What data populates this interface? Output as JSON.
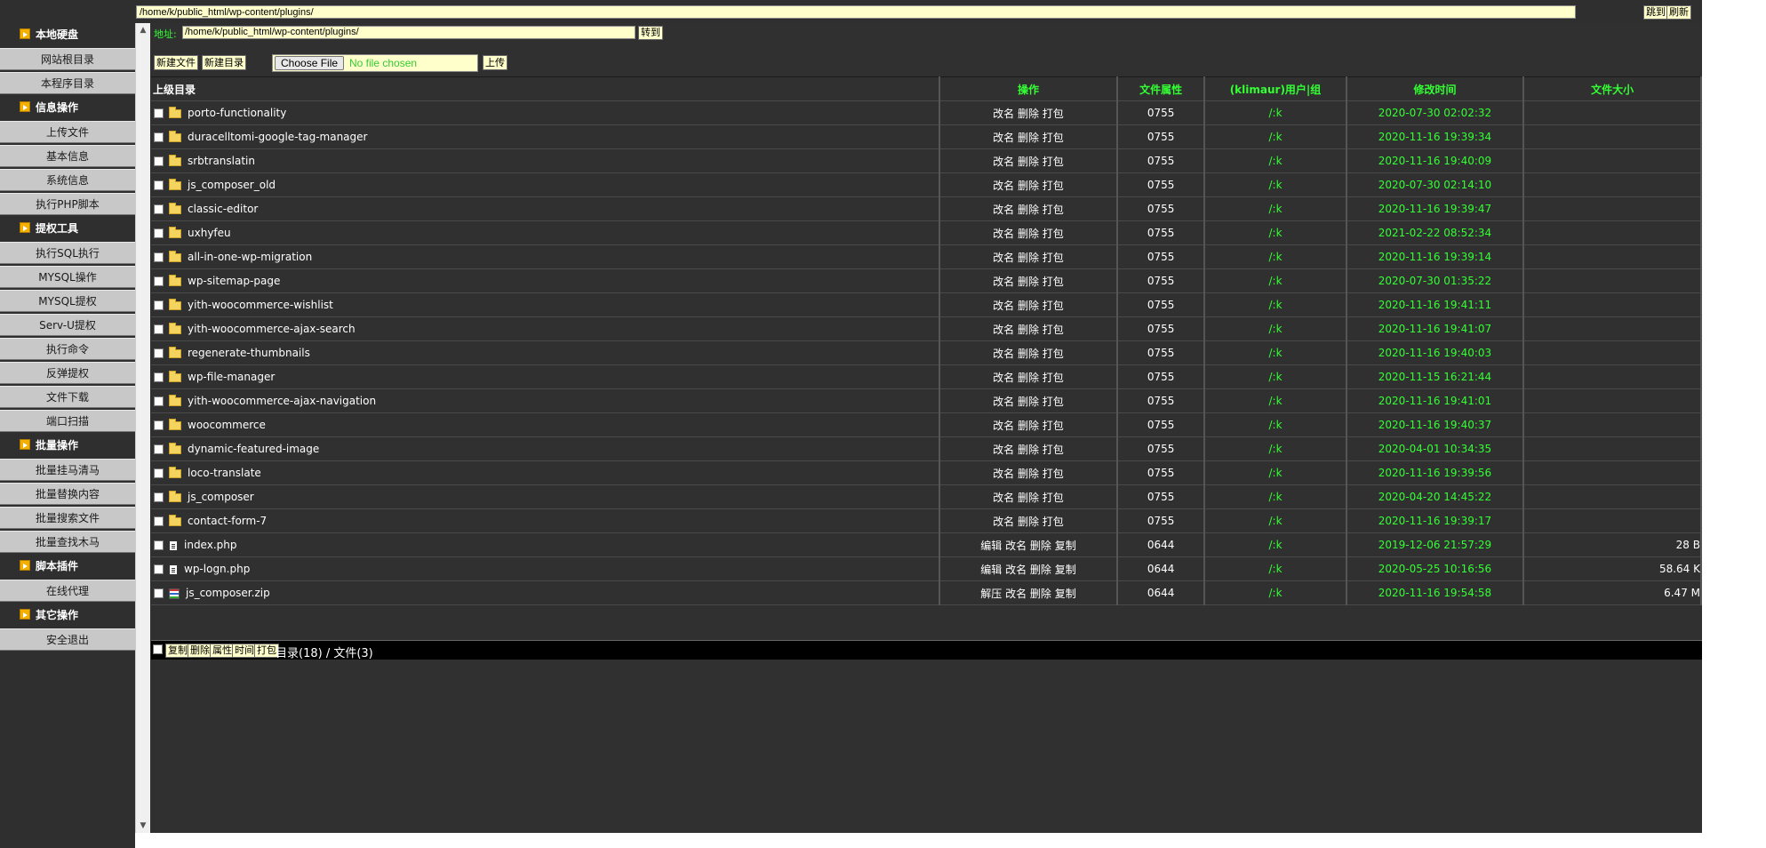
{
  "topbar": {
    "path": "/home/k/public_html/wp-content/plugins/",
    "jump_label": "跳到",
    "refresh_label": "刷新"
  },
  "sidebar": {
    "sections": [
      {
        "title": "本地硬盘",
        "items": [
          "网站根目录",
          "本程序目录"
        ]
      },
      {
        "title": "信息操作",
        "items": [
          "上传文件",
          "基本信息",
          "系统信息",
          "执行PHP脚本"
        ]
      },
      {
        "title": "提权工具",
        "items": [
          "执行SQL执行",
          "MYSQL操作",
          "MYSQL提权",
          "Serv-U提权",
          "执行命令",
          "反弹提权",
          "文件下载",
          "端口扫描"
        ]
      },
      {
        "title": "批量操作",
        "items": [
          "批量挂马清马",
          "批量替换内容",
          "批量搜索文件",
          "批量查找木马"
        ]
      },
      {
        "title": "脚本插件",
        "items": [
          "在线代理"
        ]
      },
      {
        "title": "其它操作",
        "items": [
          "安全退出"
        ]
      }
    ]
  },
  "address": {
    "label": "地址:",
    "value": "/home/k/public_html/wp-content/plugins/",
    "goto_label": "转到"
  },
  "toolbar": {
    "new_file": "新建文件",
    "new_dir": "新建目录",
    "choose_file": "Choose File",
    "no_file": "No file chosen",
    "upload": "上传"
  },
  "table": {
    "headers": {
      "name": "上级目录",
      "ops": "操作",
      "perm": "文件属性",
      "owner": "(klimaur)用户|组",
      "mtime": "修改时间",
      "size": "文件大小"
    },
    "rows": [
      {
        "type": "folder",
        "name": "porto-functionality",
        "ops": "改名 删除 打包",
        "perm": "0755",
        "owner": "/:k",
        "mtime": "2020-07-30 02:02:32",
        "size": ""
      },
      {
        "type": "folder",
        "name": "duracelltomi-google-tag-manager",
        "ops": "改名 删除 打包",
        "perm": "0755",
        "owner": "/:k",
        "mtime": "2020-11-16 19:39:34",
        "size": ""
      },
      {
        "type": "folder",
        "name": "srbtranslatin",
        "ops": "改名 删除 打包",
        "perm": "0755",
        "owner": "/:k",
        "mtime": "2020-11-16 19:40:09",
        "size": ""
      },
      {
        "type": "folder",
        "name": "js_composer_old",
        "ops": "改名 删除 打包",
        "perm": "0755",
        "owner": "/:k",
        "mtime": "2020-07-30 02:14:10",
        "size": ""
      },
      {
        "type": "folder",
        "name": "classic-editor",
        "ops": "改名 删除 打包",
        "perm": "0755",
        "owner": "/:k",
        "mtime": "2020-11-16 19:39:47",
        "size": ""
      },
      {
        "type": "folder",
        "name": "uxhyfeu",
        "ops": "改名 删除 打包",
        "perm": "0755",
        "owner": "/:k",
        "mtime": "2021-02-22 08:52:34",
        "size": ""
      },
      {
        "type": "folder",
        "name": "all-in-one-wp-migration",
        "ops": "改名 删除 打包",
        "perm": "0755",
        "owner": "/:k",
        "mtime": "2020-11-16 19:39:14",
        "size": ""
      },
      {
        "type": "folder",
        "name": "wp-sitemap-page",
        "ops": "改名 删除 打包",
        "perm": "0755",
        "owner": "/:k",
        "mtime": "2020-07-30 01:35:22",
        "size": ""
      },
      {
        "type": "folder",
        "name": "yith-woocommerce-wishlist",
        "ops": "改名 删除 打包",
        "perm": "0755",
        "owner": "/:k",
        "mtime": "2020-11-16 19:41:11",
        "size": ""
      },
      {
        "type": "folder",
        "name": "yith-woocommerce-ajax-search",
        "ops": "改名 删除 打包",
        "perm": "0755",
        "owner": "/:k",
        "mtime": "2020-11-16 19:41:07",
        "size": ""
      },
      {
        "type": "folder",
        "name": "regenerate-thumbnails",
        "ops": "改名 删除 打包",
        "perm": "0755",
        "owner": "/:k",
        "mtime": "2020-11-16 19:40:03",
        "size": ""
      },
      {
        "type": "folder",
        "name": "wp-file-manager",
        "ops": "改名 删除 打包",
        "perm": "0755",
        "owner": "/:k",
        "mtime": "2020-11-15 16:21:44",
        "size": ""
      },
      {
        "type": "folder",
        "name": "yith-woocommerce-ajax-navigation",
        "ops": "改名 删除 打包",
        "perm": "0755",
        "owner": "/:k",
        "mtime": "2020-11-16 19:41:01",
        "size": ""
      },
      {
        "type": "folder",
        "name": "woocommerce",
        "ops": "改名 删除 打包",
        "perm": "0755",
        "owner": "/:k",
        "mtime": "2020-11-16 19:40:37",
        "size": ""
      },
      {
        "type": "folder",
        "name": "dynamic-featured-image",
        "ops": "改名 删除 打包",
        "perm": "0755",
        "owner": "/:k",
        "mtime": "2020-04-01 10:34:35",
        "size": ""
      },
      {
        "type": "folder",
        "name": "loco-translate",
        "ops": "改名 删除 打包",
        "perm": "0755",
        "owner": "/:k",
        "mtime": "2020-11-16 19:39:56",
        "size": ""
      },
      {
        "type": "folder",
        "name": "js_composer",
        "ops": "改名 删除 打包",
        "perm": "0755",
        "owner": "/:k",
        "mtime": "2020-04-20 14:45:22",
        "size": ""
      },
      {
        "type": "folder",
        "name": "contact-form-7",
        "ops": "改名 删除 打包",
        "perm": "0755",
        "owner": "/:k",
        "mtime": "2020-11-16 19:39:17",
        "size": ""
      },
      {
        "type": "file",
        "name": "index.php",
        "ops": "编辑 改名 删除 复制",
        "perm": "0644",
        "owner": "/:k",
        "mtime": "2019-12-06 21:57:29",
        "size": "28 B"
      },
      {
        "type": "file",
        "name": "wp-logn.php",
        "ops": "编辑 改名 删除 复制",
        "perm": "0644",
        "owner": "/:k",
        "mtime": "2020-05-25 10:16:56",
        "size": "58.64 K"
      },
      {
        "type": "zip",
        "name": "js_composer.zip",
        "ops": "解压 改名 删除 复制",
        "perm": "0644",
        "owner": "/:k",
        "mtime": "2020-11-16 19:54:58",
        "size": "6.47 M"
      }
    ]
  },
  "footer": {
    "copy": "复制",
    "delete": "删除",
    "attr": "属性",
    "time": "时间",
    "pack": "打包",
    "summary": "目录(18) / 文件(3)"
  },
  "colors": {
    "accent_green": "#33ff33",
    "input_bg": "#ffffcc",
    "panel_bg": "#303030"
  }
}
